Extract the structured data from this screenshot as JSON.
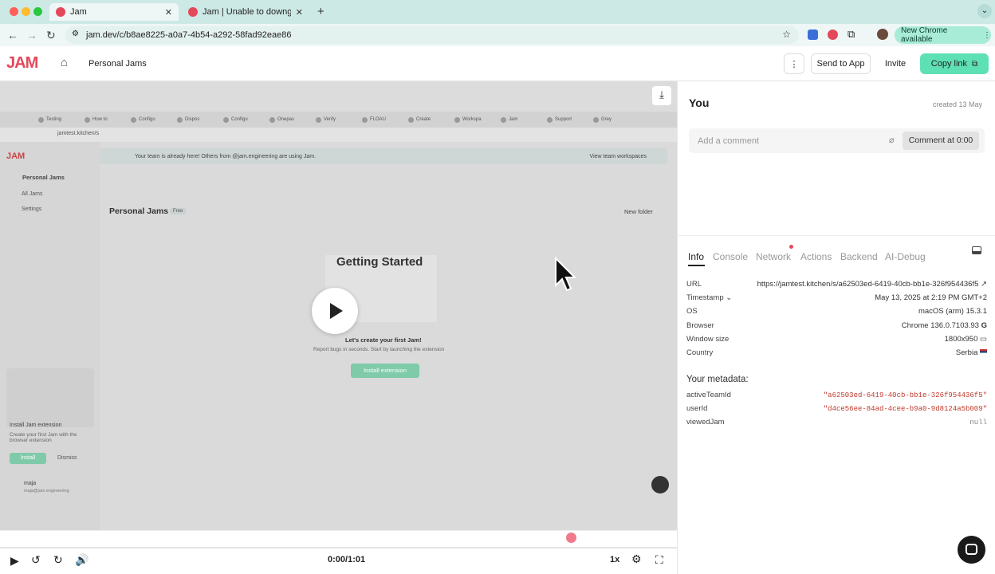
{
  "browser": {
    "tabs": [
      {
        "label": "Jam"
      },
      {
        "label": "Jam | Unable to downgrade n"
      }
    ],
    "new_tab": "+",
    "url": "jam.dev/c/b8ae8225-a0a7-4b54-a292-58fad92eae86",
    "new_chrome": "New Chrome available"
  },
  "app": {
    "logo": "JAM",
    "breadcrumb": "Personal Jams",
    "send_to_app": "Send to App",
    "invite": "Invite",
    "copy_link": "Copy link"
  },
  "video": {
    "inner_tabs": [
      "Testing",
      "How to",
      "Configu",
      "Dispos",
      "Configu",
      "Onepas",
      "Verify",
      "FLOAU",
      "Create",
      "Workspa",
      "Jam",
      "Support",
      "Grey"
    ],
    "inner_url": "jamtest.kitchen/s",
    "banner_text": "Your team is already here! Others from @jam.engineering are using Jam.",
    "banner_link": "View team workspaces",
    "sidebar_workspace": "Personal Jams",
    "sidebar_items": [
      "All Jams",
      "Settings"
    ],
    "page_title": "Personal Jams",
    "page_badge": "Free",
    "new_folder": "New folder",
    "getting_started": "Getting Started",
    "create_title": "Let's create your first Jam!",
    "create_sub": "Report bugs in seconds. Start by launching the extension",
    "install_extension": "Install extension",
    "install_card_title": "Install Jam extension",
    "install_card_sub": "Create your first Jam with the browser extension",
    "install_btn": "Install",
    "dismiss_btn": "Dismiss",
    "user_name": "maja",
    "user_email": "maja@jam.engineering"
  },
  "player": {
    "time": "0:00/1:01",
    "speed": "1x"
  },
  "panel": {
    "author": "You",
    "created": "created 13 May",
    "comment_placeholder": "Add a comment",
    "comment_btn": "Comment at 0:00",
    "tabs": [
      "Info",
      "Console",
      "Network",
      "Actions",
      "Backend",
      "AI-Debug"
    ],
    "active_tab": "Info",
    "info": [
      {
        "key": "URL",
        "value": "https://jamtest.kitchen/s/a62503ed-6419-40cb-bb1e-326f954436f5"
      },
      {
        "key": "Timestamp",
        "value": "May 13, 2025 at 2:19 PM GMT+2"
      },
      {
        "key": "OS",
        "value": "macOS (arm) 15.3.1"
      },
      {
        "key": "Browser",
        "value": "Chrome 136.0.7103.93"
      },
      {
        "key": "Window size",
        "value": "1800x950"
      },
      {
        "key": "Country",
        "value": "Serbia"
      }
    ],
    "metadata_title": "Your metadata:",
    "metadata": [
      {
        "key": "activeTeamId",
        "value": "\"a62503ed-6419-40cb-bb1e-326f954436f5\""
      },
      {
        "key": "userId",
        "value": "\"d4ce56ee-84ad-4cee-b9a0-9d8124a5b009\""
      },
      {
        "key": "viewedJam",
        "value": "null"
      }
    ]
  },
  "colors": {
    "accent": "#5ee0b5",
    "brand": "#e4485b"
  }
}
